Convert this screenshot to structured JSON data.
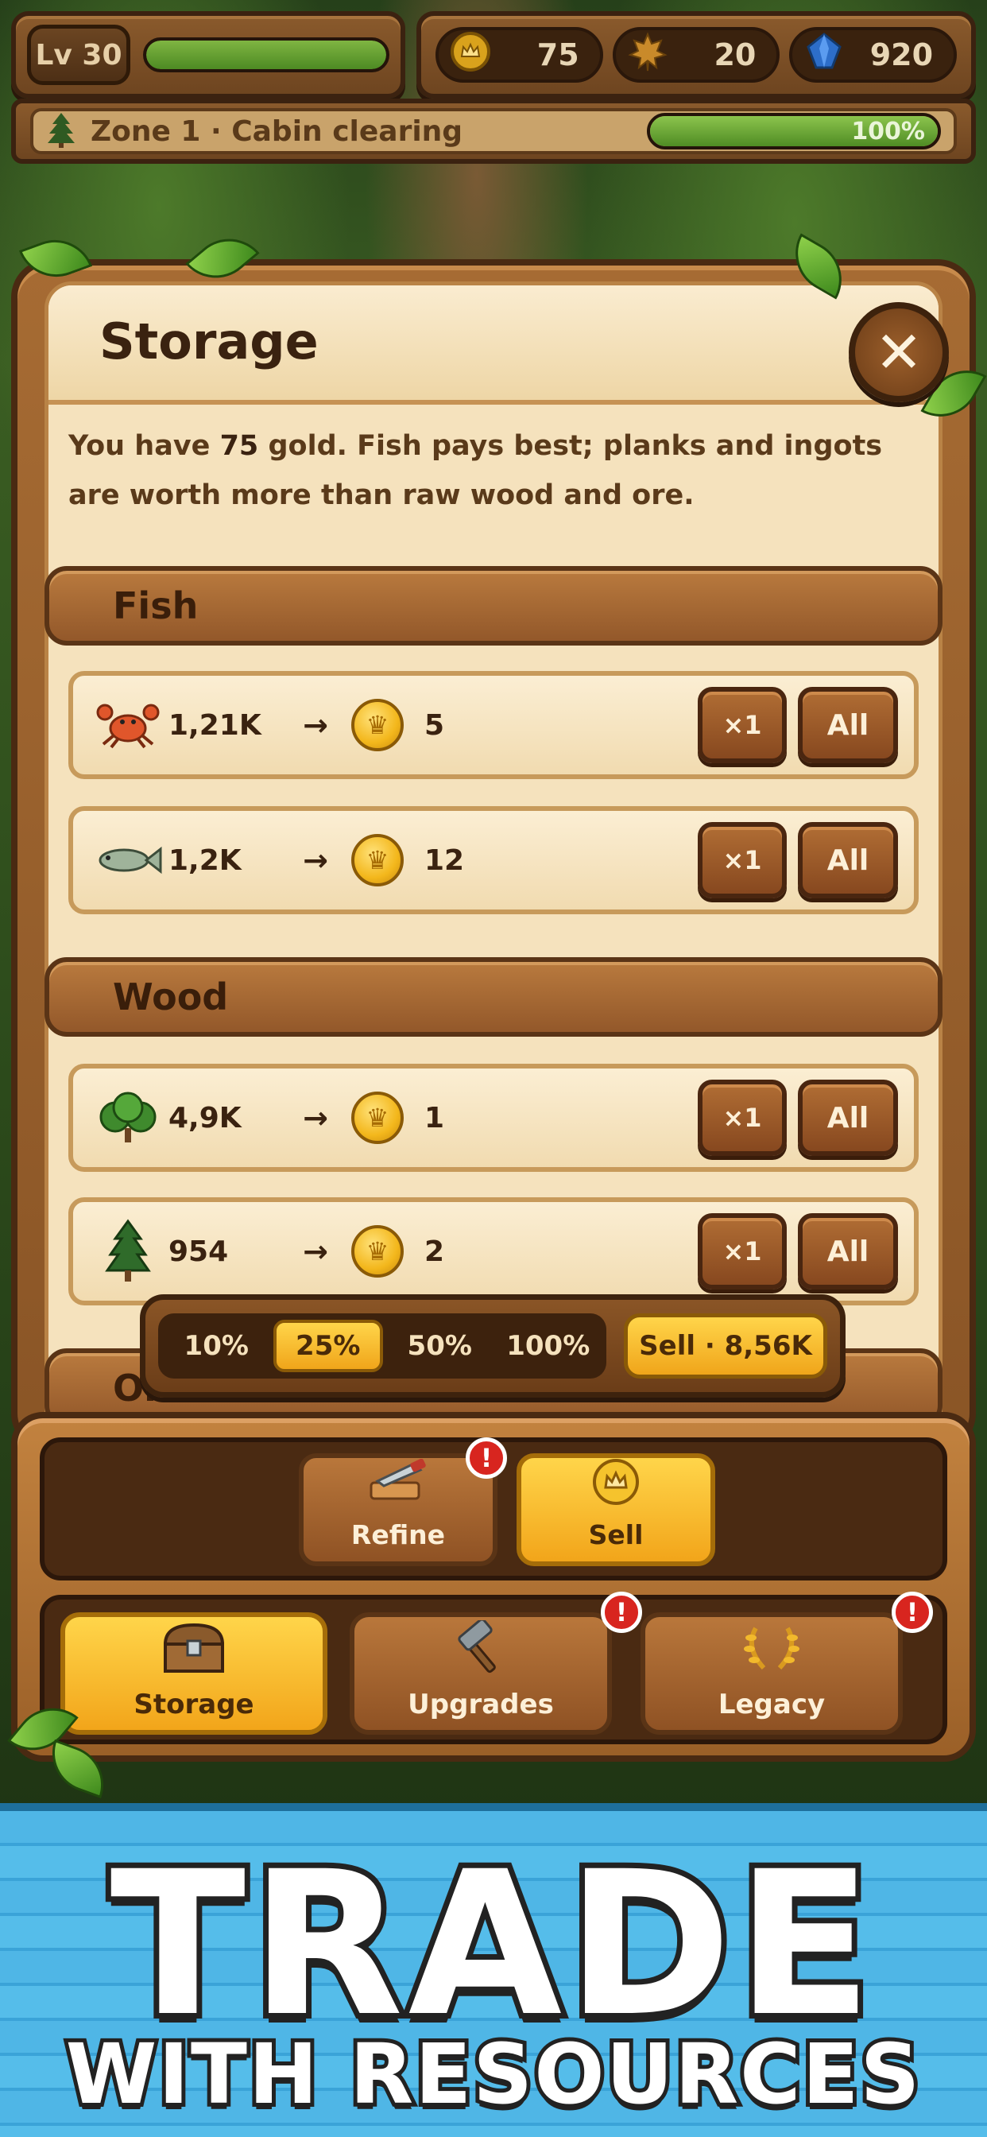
{
  "hud": {
    "level": "Lv 30",
    "xp_fraction": 1.0,
    "gold": "75",
    "leaves": "20",
    "gems": "920",
    "zone": "Zone 1 · Cabin clearing",
    "zone_progress": "100%"
  },
  "storage": {
    "title": "Storage",
    "intro_prefix": "You have ",
    "intro_gold": "75",
    "intro_suffix": " gold. Fish pays best; planks and ingots are worth more than raw wood and ore.",
    "close_label": "✕",
    "sections": [
      {
        "name": "Fish",
        "rows": [
          {
            "icon": "crab-icon",
            "amount": "1,21K",
            "price": "5"
          },
          {
            "icon": "fish-icon",
            "amount": "1,2K",
            "price": "12"
          }
        ]
      },
      {
        "name": "Wood",
        "rows": [
          {
            "icon": "bush-icon",
            "amount": "4,9K",
            "price": "1"
          },
          {
            "icon": "pine-tree-icon",
            "amount": "954",
            "price": "2"
          }
        ]
      },
      {
        "name": "Ore",
        "rows": []
      }
    ],
    "arrow": "→",
    "btn_x1": "×1",
    "btn_all": "All",
    "percent_options": [
      "10%",
      "25%",
      "50%",
      "100%"
    ],
    "percent_selected": "25%",
    "sell_label": "Sell · 8,56K"
  },
  "dock": {
    "subtabs": [
      {
        "label": "Refine",
        "icon": "saw-plank-icon",
        "badge": "!"
      },
      {
        "label": "Sell",
        "icon": "coin-icon",
        "active": true
      }
    ],
    "tabs": [
      {
        "label": "Storage",
        "icon": "chest-icon",
        "active": true
      },
      {
        "label": "Upgrades",
        "icon": "hammer-icon",
        "badge": "!"
      },
      {
        "label": "Legacy",
        "icon": "laurel-icon",
        "badge": "!"
      }
    ]
  },
  "banner": {
    "line1": "TRADE",
    "line2": "WITH RESOURCES"
  },
  "colors": {
    "wood": "#8a5526",
    "paper": "#f5e2bd",
    "gold_accent": "#f0a51a",
    "alert_red": "#d8251f",
    "banner_blue": "#4fb6e6"
  }
}
